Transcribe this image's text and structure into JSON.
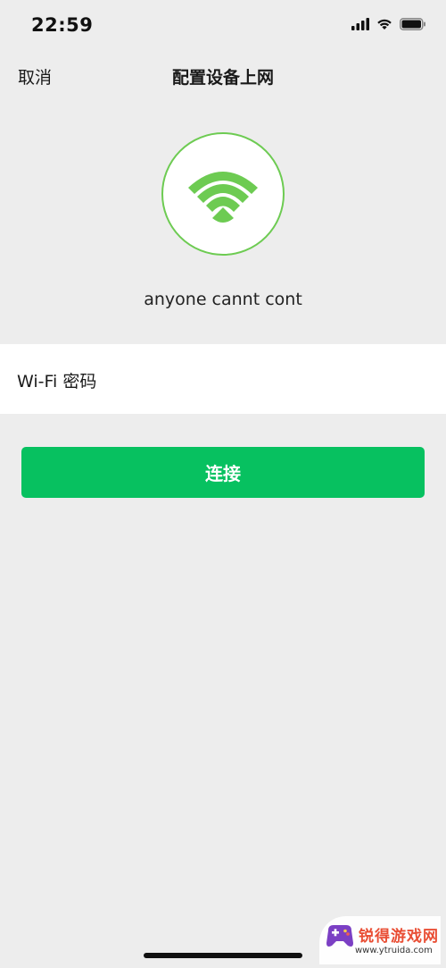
{
  "status_bar": {
    "time": "22:59"
  },
  "nav": {
    "cancel_label": "取消",
    "title": "配置设备上网"
  },
  "network": {
    "ssid": "anyone cannt cont"
  },
  "password": {
    "label": "Wi-Fi 密码",
    "value": "",
    "placeholder": ""
  },
  "connect_label": "连接",
  "watermark": {
    "title": "锐得游戏网",
    "url": "www.ytruida.com"
  },
  "colors": {
    "accent_green": "#07c160",
    "wifi_green": "#6dcb52",
    "background": "#ededed"
  },
  "icons": [
    "signal-icon",
    "wifi-status-icon",
    "battery-icon",
    "wifi-icon"
  ]
}
